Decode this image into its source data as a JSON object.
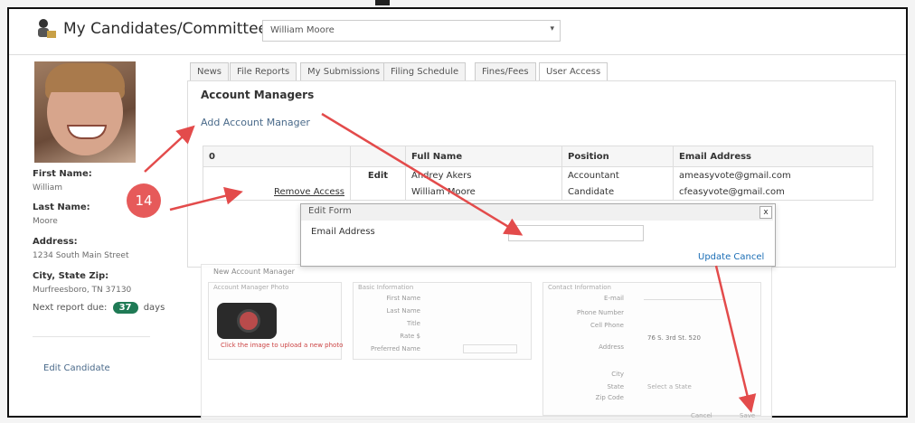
{
  "header": {
    "title": "My Candidates/Committees",
    "selected_candidate": "William Moore"
  },
  "profile": {
    "first_name_label": "First Name:",
    "first_name": "William",
    "last_name_label": "Last Name:",
    "last_name": "Moore",
    "address_label": "Address:",
    "address": "1234 South Main Street",
    "city_label": "City, State Zip:",
    "city": "Murfreesboro, TN 37130",
    "next_report_prefix": "Next report due:",
    "next_report_days": "37",
    "next_report_suffix": "days",
    "edit_candidate": "Edit Candidate"
  },
  "tabs": [
    "News",
    "File Reports",
    "My Submissions",
    "Filing Schedule",
    "Fines/Fees",
    "User Access"
  ],
  "account_managers": {
    "heading": "Account Managers",
    "add_link": "Add Account Manager",
    "columns": [
      "0",
      "",
      "Full Name",
      "Position",
      "Email Address"
    ],
    "rows": [
      {
        "action": "",
        "edit": "Edit",
        "name": "Andrey Akers",
        "position": "Accountant",
        "email": "ameasyvote@gmail.com"
      },
      {
        "action": "Remove Access",
        "edit": "",
        "name": "William Moore",
        "position": "Candidate",
        "email": "cfeasyvote@gmail.com"
      }
    ]
  },
  "edit_form": {
    "title": "Edit Form",
    "close": "x",
    "email_label": "Email Address",
    "email_value": "",
    "update": "Update",
    "cancel": "Cancel"
  },
  "new_account_manager": {
    "title": "New Account Manager",
    "photo_section": "Account Manager Photo",
    "photo_hint": "Click the image to upload a new photo",
    "basic_section": "Basic Information",
    "basic_fields": [
      "First Name",
      "Last Name",
      "Title",
      "Rate $",
      "Preferred Name"
    ],
    "contact_section": "Contact Information",
    "contact_fields": [
      "E-mail",
      "Phone Number",
      "Cell Phone",
      "Address",
      "City",
      "State",
      "Zip Code"
    ],
    "address_value": "76 S. 3rd St. 520",
    "state_value": "Select a State",
    "cancel": "Cancel",
    "save": "Save"
  },
  "annotation": {
    "step_number": "14"
  },
  "colors": {
    "arrow": "#e34b4b",
    "badge": "#1f7a55",
    "link": "#1a6db5"
  }
}
